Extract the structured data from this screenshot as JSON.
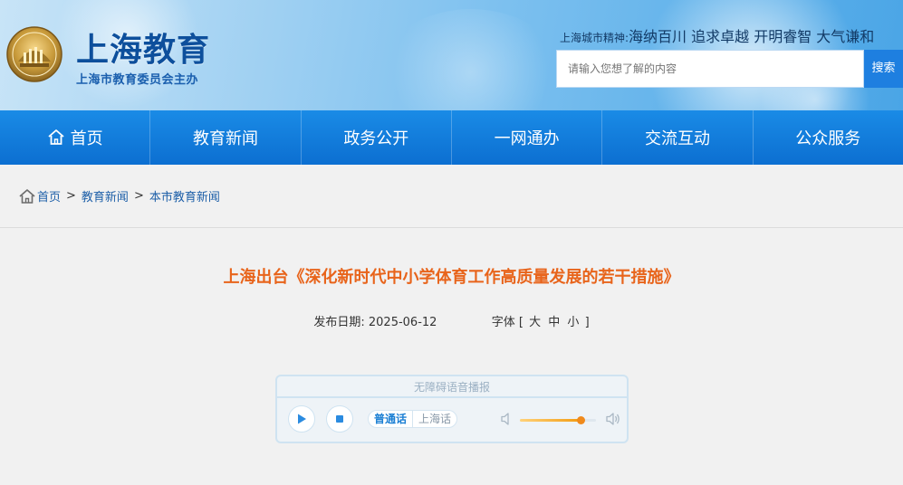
{
  "header": {
    "title": "上海教育",
    "subtitle": "上海市教育委员会主办",
    "spirit_label": "上海城市精神:",
    "spirit_text": "海纳百川 追求卓越 开明睿智 大气谦和",
    "search_placeholder": "请输入您想了解的内容",
    "search_button": "搜索",
    "emblem_icon": "shanghai-emblem-icon"
  },
  "nav": {
    "items": [
      "首页",
      "教育新闻",
      "政务公开",
      "一网通办",
      "交流互动",
      "公众服务"
    ]
  },
  "breadcrumb": {
    "items": [
      "首页",
      "教育新闻",
      "本市教育新闻"
    ],
    "separator": ">"
  },
  "article": {
    "title": "上海出台《深化新时代中小学体育工作高质量发展的若干措施》",
    "date_label": "发布日期:",
    "date": "2025-06-12",
    "font_label": "字体",
    "font_open": "[",
    "font_sizes": [
      "大",
      "中",
      "小"
    ],
    "font_close": "]"
  },
  "player": {
    "title": "无障碍语音播报",
    "lang_mandarin": "普通话",
    "lang_shanghainese": "上海话",
    "volume": 0.8
  },
  "colors": {
    "nav_bg": "#0c6fd1",
    "title_orange": "#e8641b",
    "link_blue": "#1d5fa8",
    "search_btn": "#1e7fe0"
  }
}
